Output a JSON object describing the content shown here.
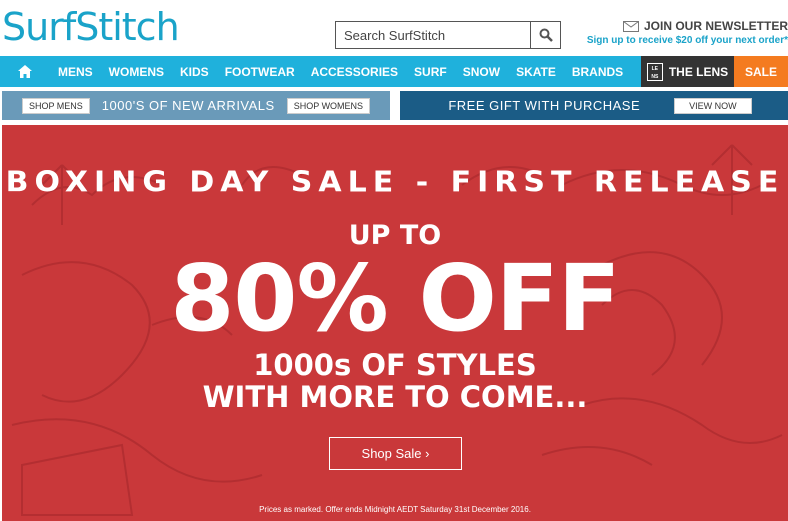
{
  "header": {
    "logo_text": "SurfStitch",
    "search_placeholder": "Search SurfStitch",
    "newsletter_title": "JOIN OUR NEWSLETTER",
    "newsletter_sub": "Sign up to receive $20 off your next order*"
  },
  "nav": {
    "items": [
      "MENS",
      "WOMENS",
      "KIDS",
      "FOOTWEAR",
      "ACCESSORIES",
      "SURF",
      "SNOW",
      "SKATE",
      "BRANDS"
    ],
    "lens_label": "THE LENS",
    "lens_icon_text": "LE NS",
    "sale_label": "SALE",
    "colors": {
      "nav_bg": "#1fb1dc",
      "lens_bg": "#333333",
      "sale_bg": "#f47b20"
    }
  },
  "promo": {
    "shop_mens": "SHOP MENS",
    "new_arrivals": "1000'S OF NEW ARRIVALS",
    "shop_womens": "SHOP WOMENS",
    "gift": "FREE GIFT WITH PURCHASE",
    "view_now": "VIEW NOW"
  },
  "hero": {
    "title": "BOXING DAY SALE - FIRST RELEASE",
    "up_to": "UP TO",
    "discount": "80% OFF",
    "line1": "1000s OF STYLES",
    "line2": "WITH MORE TO COME...",
    "cta": "Shop Sale ›",
    "fine_print": "Prices as marked. Offer ends Midnight AEDT Saturday 31st December 2016.",
    "bg_color": "#c9383a"
  }
}
